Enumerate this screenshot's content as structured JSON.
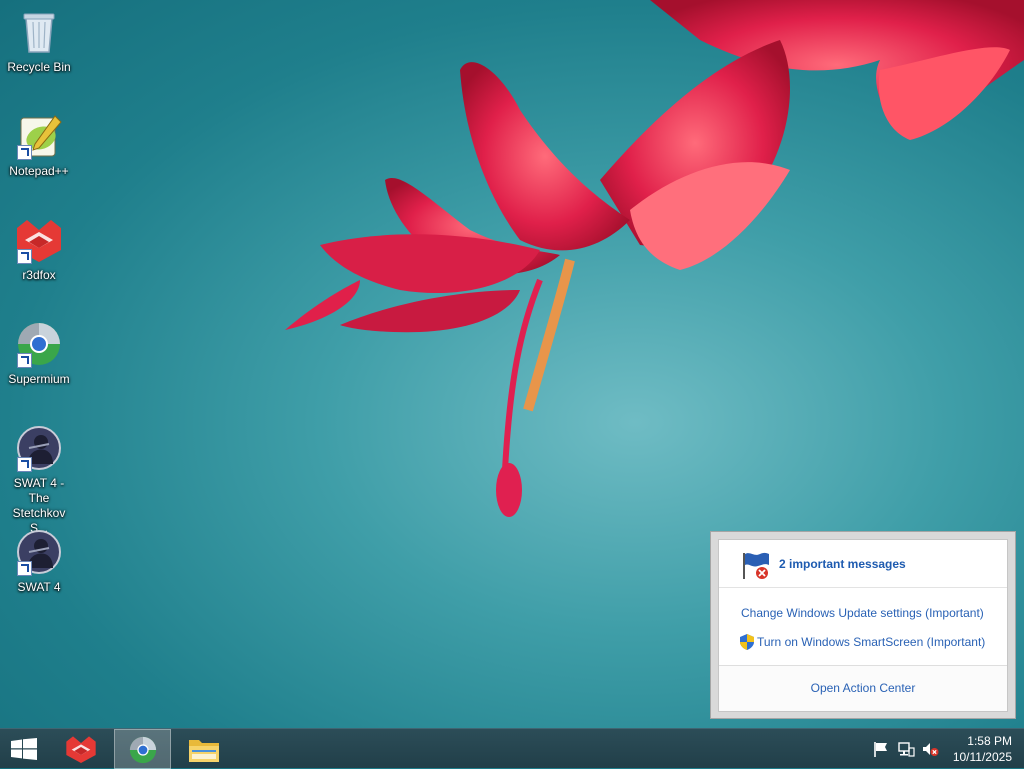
{
  "desktop": {
    "icons": [
      {
        "label": "Recycle Bin",
        "icon": "recycle-bin-icon",
        "shortcut": false
      },
      {
        "label": "Notepad++",
        "icon": "notepad-plus-plus-icon",
        "shortcut": true
      },
      {
        "label": "r3dfox",
        "icon": "r3dfox-icon",
        "shortcut": true
      },
      {
        "label": "Supermium",
        "icon": "supermium-icon",
        "shortcut": true
      },
      {
        "label": "SWAT 4 - The Stetchkov S...",
        "icon": "swat4-icon",
        "shortcut": true
      },
      {
        "label": "SWAT 4",
        "icon": "swat4-icon",
        "shortcut": true
      }
    ]
  },
  "notification": {
    "title": "2 important messages",
    "messages": [
      {
        "text": "Change Windows Update settings (Important)"
      },
      {
        "text": "Turn on Windows SmartScreen (Important)"
      }
    ],
    "footer": "Open Action Center"
  },
  "taskbar": {
    "buttons": [
      {
        "name": "start-button",
        "icon": "windows-logo-icon"
      },
      {
        "name": "r3dfox",
        "icon": "r3dfox-icon"
      },
      {
        "name": "supermium",
        "icon": "supermium-icon",
        "active": true
      },
      {
        "name": "file-explorer",
        "icon": "folder-icon"
      }
    ],
    "tray": {
      "time": "1:58 PM",
      "date": "10/11/2025"
    }
  },
  "colors": {
    "accent_link": "#2a62b5",
    "taskbar": "#213f49",
    "wallpaper": "#3f9ea8"
  }
}
